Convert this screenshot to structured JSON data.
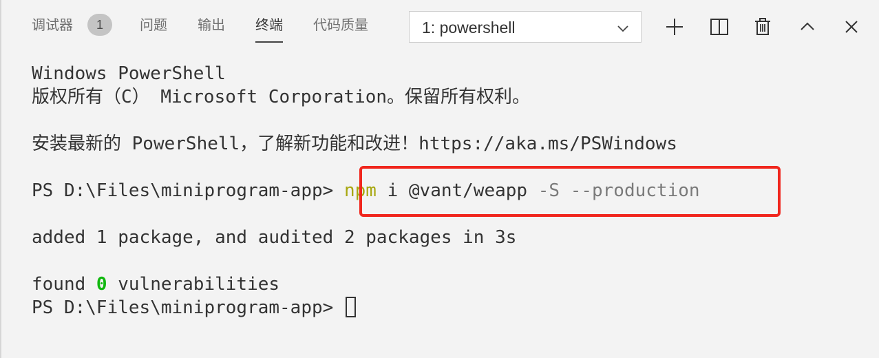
{
  "tabs": [
    {
      "label": "调试器",
      "badge": "1"
    },
    {
      "label": "问题"
    },
    {
      "label": "输出"
    },
    {
      "label": "终端",
      "active": true
    },
    {
      "label": "代码质量"
    }
  ],
  "terminal_select": {
    "value": "1: powershell"
  },
  "toolbar_icons": [
    "plus-icon",
    "split-icon",
    "trash-icon",
    "chevron-up-icon",
    "close-icon"
  ],
  "terminal": {
    "line1": "Windows PowerShell",
    "line2": "版权所有（C） Microsoft Corporation。保留所有权利。",
    "line3": "安装最新的 PowerShell，了解新功能和改进！https://aka.ms/PSWindows",
    "prompt": "PS D:\\Files\\miniprogram-app>",
    "cmd_npm": "npm",
    "cmd_args": " i @vant/weapp ",
    "cmd_flags": "-S --production",
    "added": "added 1 package, and audited 2 packages in 3s",
    "found_prefix": "found ",
    "found_count": "0",
    "found_suffix": " vulnerabilities"
  },
  "colors": {
    "highlight_border": "#f0261d",
    "npm": "#a7a70f",
    "zero": "#11b80f"
  }
}
